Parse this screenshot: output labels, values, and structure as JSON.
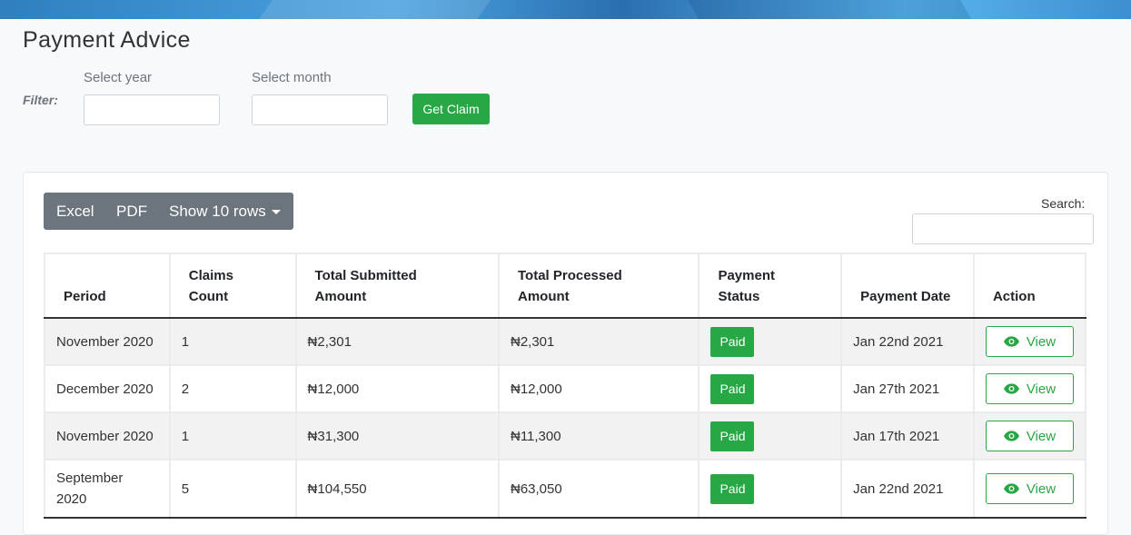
{
  "page": {
    "title": "Payment Advice"
  },
  "filter": {
    "label": "Filter:",
    "year_label": "Select year",
    "year_value": "",
    "month_label": "Select month",
    "month_value": "",
    "submit_label": "Get Claim"
  },
  "toolbar": {
    "excel": "Excel",
    "pdf": "PDF",
    "rows": "Show 10 rows"
  },
  "search": {
    "label": "Search:",
    "value": ""
  },
  "table": {
    "headers": {
      "period": "Period",
      "claims_count_1": "Claims",
      "claims_count_2": "Count",
      "submitted_1": "Total Submitted",
      "submitted_2": "Amount",
      "processed_1": "Total Processed",
      "processed_2": "Amount",
      "status_1": "Payment",
      "status_2": "Status",
      "date": "Payment Date",
      "action": "Action"
    },
    "rows": [
      {
        "period": "November 2020",
        "count": "1",
        "submitted": "₦2,301",
        "processed": "₦2,301",
        "status": "Paid",
        "date": "Jan 22nd 2021",
        "action": "View"
      },
      {
        "period": "December 2020",
        "count": "2",
        "submitted": "₦12,000",
        "processed": "₦12,000",
        "status": "Paid",
        "date": "Jan 27th 2021",
        "action": "View"
      },
      {
        "period": "November 2020",
        "count": "1",
        "submitted": "₦31,300",
        "processed": "₦11,300",
        "status": "Paid",
        "date": "Jan 17th 2021",
        "action": "View"
      },
      {
        "period_1": "September",
        "period_2": "2020",
        "count": "5",
        "submitted": "₦104,550",
        "processed": "₦63,050",
        "status": "Paid",
        "date": "Jan 22nd 2021",
        "action": "View"
      }
    ]
  },
  "colors": {
    "accent": "#28a745",
    "toolbar": "#6c757d"
  }
}
